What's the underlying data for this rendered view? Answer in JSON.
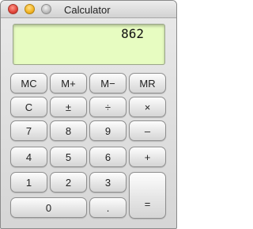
{
  "window": {
    "title": "Calculator"
  },
  "display": {
    "value": "862"
  },
  "keys": {
    "mc": "MC",
    "m_plus": "M+",
    "m_minus": "M−",
    "mr": "MR",
    "clear": "C",
    "sign": "±",
    "divide": "÷",
    "multiply": "×",
    "seven": "7",
    "eight": "8",
    "nine": "9",
    "subtract": "–",
    "four": "4",
    "five": "5",
    "six": "6",
    "add": "+",
    "one": "1",
    "two": "2",
    "three": "3",
    "zero": "0",
    "point": ".",
    "equals": "="
  },
  "colors": {
    "display_bg": "#e7fcc1",
    "close": "#e0443a",
    "minimize": "#f2b423"
  }
}
